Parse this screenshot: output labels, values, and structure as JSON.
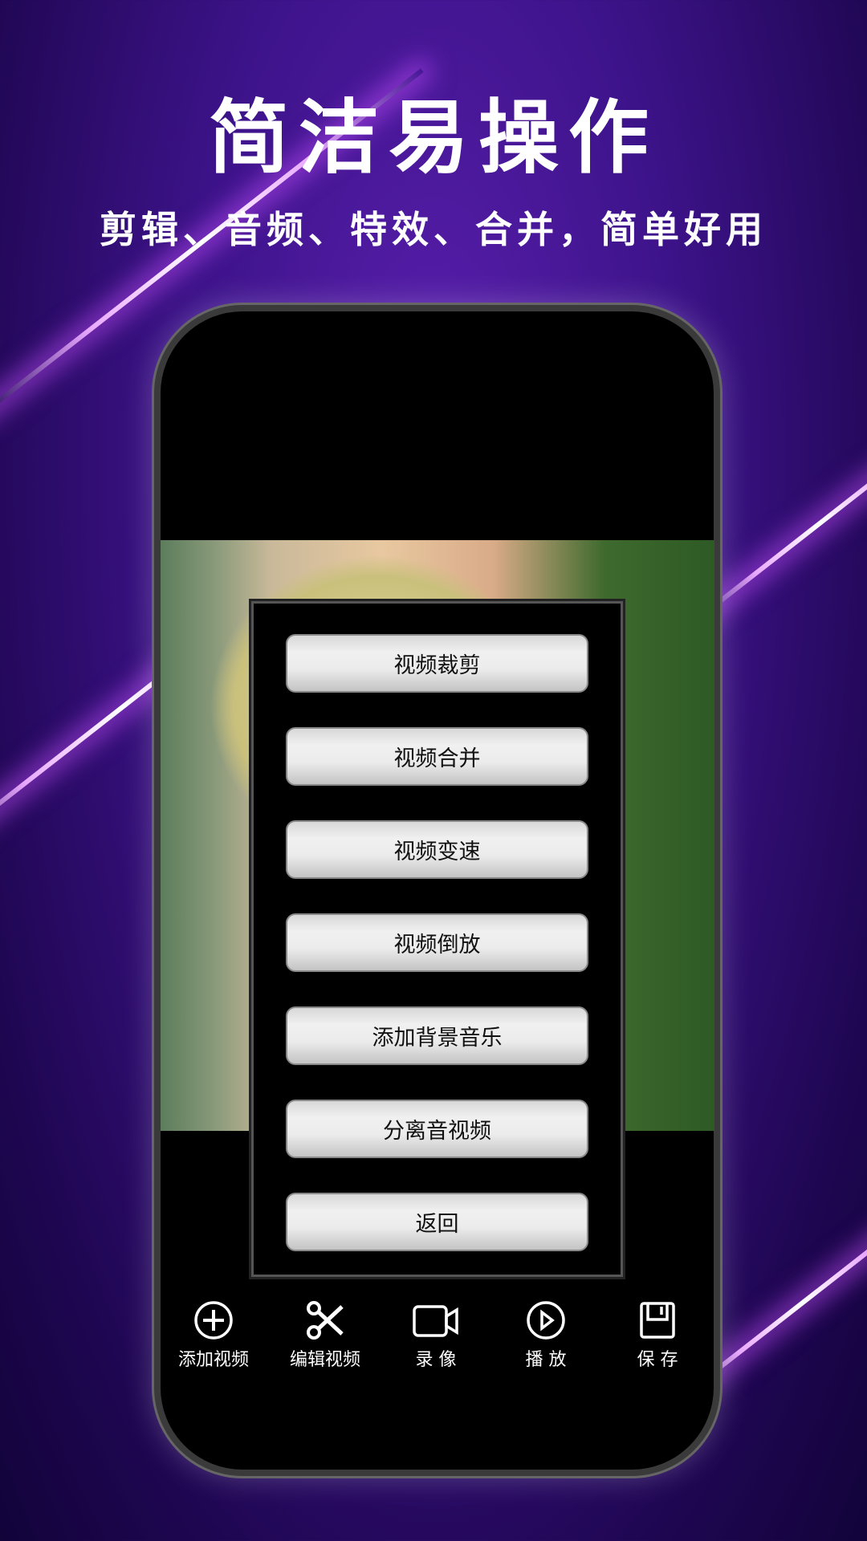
{
  "header": {
    "title": "简洁易操作",
    "subtitle": "剪辑、音频、特效、合并，简单好用"
  },
  "menu": {
    "items": [
      "视频裁剪",
      "视频合并",
      "视频变速",
      "视频倒放",
      "添加背景音乐",
      "分离音视频",
      "返回"
    ]
  },
  "toolbar": {
    "items": [
      {
        "label": "添加视频",
        "icon": "plus-circle-icon"
      },
      {
        "label": "编辑视频",
        "icon": "scissors-icon"
      },
      {
        "label": "录 像",
        "icon": "video-camera-icon"
      },
      {
        "label": "播 放",
        "icon": "play-icon"
      },
      {
        "label": "保 存",
        "icon": "save-icon"
      }
    ]
  },
  "colors": {
    "background": "#3d138a",
    "accent": "#e9a8ff"
  }
}
